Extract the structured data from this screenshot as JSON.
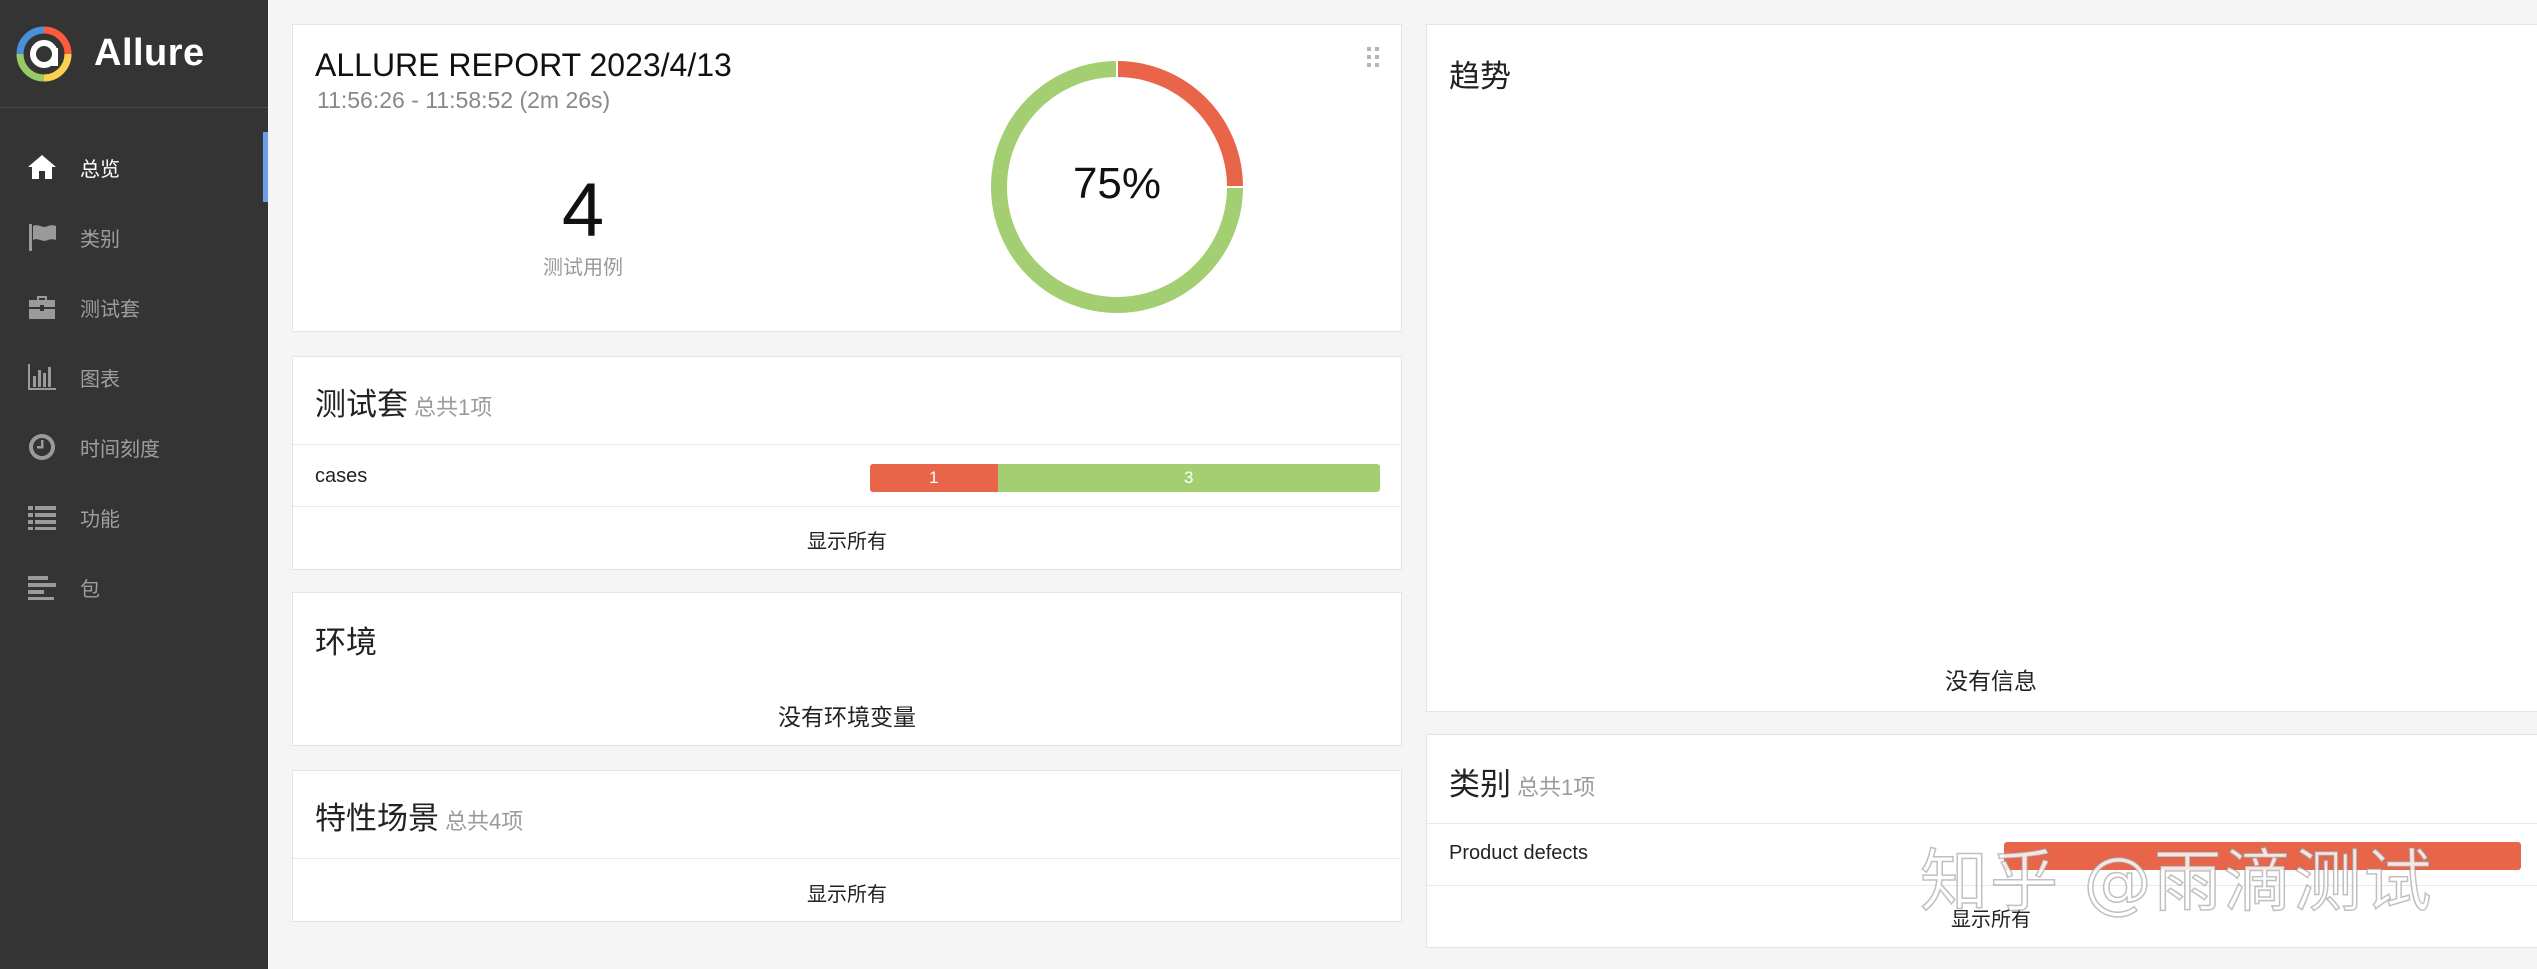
{
  "app": {
    "name": "Allure"
  },
  "sidebar": {
    "items": [
      {
        "label": "总览",
        "icon": "home-icon",
        "active": true
      },
      {
        "label": "类别",
        "icon": "flag-icon",
        "active": false
      },
      {
        "label": "测试套",
        "icon": "briefcase-icon",
        "active": false
      },
      {
        "label": "图表",
        "icon": "bar-chart-icon",
        "active": false
      },
      {
        "label": "时间刻度",
        "icon": "clock-icon",
        "active": false
      },
      {
        "label": "功能",
        "icon": "list-icon",
        "active": false
      },
      {
        "label": "包",
        "icon": "align-left-icon",
        "active": false
      }
    ]
  },
  "summary": {
    "title": "ALLURE REPORT 2023/4/13",
    "time_range": "11:56:26 - 11:58:52 (2m 26s)",
    "case_count": "4",
    "case_label": "测试用例",
    "pass_rate": "75%",
    "colors": {
      "failed": "#fd5a3e",
      "passed": "#97cc64"
    }
  },
  "chart_data": {
    "type": "pie",
    "style": "donut",
    "center_label": "75%",
    "slices": [
      {
        "value": 1,
        "color": "#e8654a"
      },
      {
        "value": 3,
        "color": "#a3cf72"
      }
    ]
  },
  "suites": {
    "title": "测试套",
    "total": "总共1项",
    "rows": [
      {
        "name": "cases",
        "failed": "1",
        "passed": "3",
        "failed_count": 1,
        "passed_count": 3
      }
    ],
    "show_all": "显示所有"
  },
  "environment": {
    "title": "环境",
    "empty": "没有环境变量"
  },
  "features": {
    "title": "特性场景",
    "total": "总共4项",
    "show_all": "显示所有"
  },
  "trend": {
    "title": "趋势",
    "empty": "没有信息"
  },
  "categories": {
    "title": "类别",
    "total": "总共1项",
    "rows": [
      {
        "name": "Product defects",
        "count": 1
      }
    ],
    "show_all": "显示所有"
  },
  "watermark": "知乎 @雨滴测试"
}
